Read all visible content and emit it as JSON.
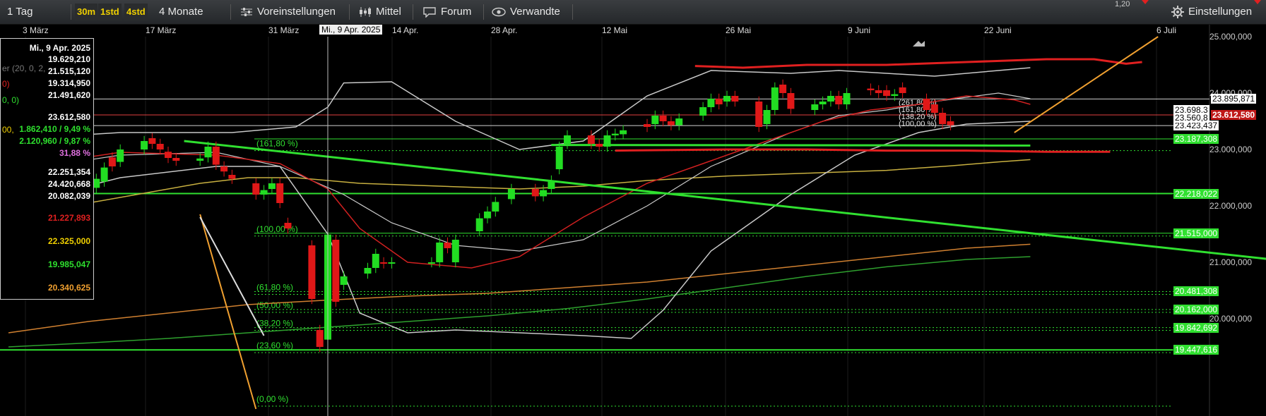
{
  "toolbar": {
    "period": "1 Tag",
    "interval_30m": "30m",
    "interval_1std": "1std",
    "interval_4std": "4std",
    "range": "4 Monate",
    "presets": "Voreinstellungen",
    "average": "Mittel",
    "forum": "Forum",
    "related": "Verwandte",
    "settings": "Einstellungen",
    "top_value": "1,20"
  },
  "date_axis": {
    "labels": [
      "3 März",
      "17 März",
      "31 März",
      "14 Apr.",
      "28 Apr.",
      "12 Mai",
      "26 Mai",
      "9 Juni",
      "22 Juni",
      "6 Juli"
    ],
    "crosshair_label": "Mi., 9 Apr. 2025"
  },
  "infobox": {
    "date": "Mi., 9 Apr. 2025",
    "values": [
      {
        "text": "19.629,210",
        "color": "#ffffff"
      },
      {
        "text": "21.515,120",
        "color": "#ffffff"
      },
      {
        "text": "19.314,950",
        "color": "#ffffff"
      },
      {
        "text": "21.491,620",
        "color": "#ffffff"
      },
      {
        "text": "23.612,580",
        "color": "#ffffff"
      },
      {
        "text": "1.862,410 / 9,49 %",
        "color": "#2ee02e"
      },
      {
        "text": "2.120,960 / 9,87 %",
        "color": "#2ee02e"
      },
      {
        "text": "31,88 %",
        "color": "#e070e0"
      },
      {
        "text": "22.251,354",
        "color": "#ffffff"
      },
      {
        "text": "24.420,668",
        "color": "#ffffff"
      },
      {
        "text": "20.082,039",
        "color": "#ffffff"
      },
      {
        "text": "21.227,893",
        "color": "#e02020"
      },
      {
        "text": "22.325,000",
        "color": "#f0d000"
      },
      {
        "text": "19.985,047",
        "color": "#2ee02e"
      },
      {
        "text": "20.340,625",
        "color": "#f0a030"
      }
    ],
    "left_fragments": [
      "er (20, 0, 2,",
      "0)",
      "0, 0)",
      "00,"
    ]
  },
  "chart_data": {
    "type": "candlestick",
    "x_start": "2025-02-28",
    "ylim": [
      18400,
      25000
    ],
    "y_ticks": [
      "25.000,000",
      "24.000,000",
      "23.000,000",
      "22.000,000",
      "21.000,000",
      "20.000,000"
    ],
    "crosshair_date": "2025-04-09",
    "candles": [
      {
        "d": "2025-02-28",
        "o": 22650,
        "c": 22520
      },
      {
        "d": "2025-03-03",
        "o": 22550,
        "c": 22500
      },
      {
        "d": "2025-03-04",
        "o": 22530,
        "c": 22320
      },
      {
        "d": "2025-03-05",
        "o": 22350,
        "c": 22500
      },
      {
        "d": "2025-03-06",
        "o": 22500,
        "c": 22320
      },
      {
        "d": "2025-03-07",
        "o": 22320,
        "c": 22450
      },
      {
        "d": "2025-03-10",
        "o": 22450,
        "c": 22280
      },
      {
        "d": "2025-03-11",
        "o": 22320,
        "c": 22480
      },
      {
        "d": "2025-03-12",
        "o": 22430,
        "c": 22680
      },
      {
        "d": "2025-03-13",
        "o": 22860,
        "c": 22700
      },
      {
        "d": "2025-03-14",
        "o": 22780,
        "c": 23000
      },
      {
        "d": "2025-03-17",
        "o": 23000,
        "c": 23150
      },
      {
        "d": "2025-03-18",
        "o": 23200,
        "c": 23100
      },
      {
        "d": "2025-03-19",
        "o": 23100,
        "c": 23000
      },
      {
        "d": "2025-03-20",
        "o": 22960,
        "c": 22850
      },
      {
        "d": "2025-03-21",
        "o": 22850,
        "c": 22800
      },
      {
        "d": "2025-03-24",
        "o": 22800,
        "c": 22840
      },
      {
        "d": "2025-03-25",
        "o": 22860,
        "c": 23050
      },
      {
        "d": "2025-03-26",
        "o": 23050,
        "c": 22730
      },
      {
        "d": "2025-03-27",
        "o": 22700,
        "c": 22610
      },
      {
        "d": "2025-03-28",
        "o": 22550,
        "c": 22480
      },
      {
        "d": "2025-03-31",
        "o": 22400,
        "c": 22200
      },
      {
        "d": "2025-04-01",
        "o": 22200,
        "c": 22280
      },
      {
        "d": "2025-04-02",
        "o": 22300,
        "c": 22400
      },
      {
        "d": "2025-04-03",
        "o": 22400,
        "c": 22050
      },
      {
        "d": "2025-04-04",
        "o": 21700,
        "c": 21600
      },
      {
        "d": "2025-04-07",
        "o": 21300,
        "c": 20350
      },
      {
        "d": "2025-04-08",
        "o": 19800,
        "c": 19500
      },
      {
        "d": "2025-04-09",
        "o": 19629,
        "c": 21492
      },
      {
        "d": "2025-04-10",
        "o": 21400,
        "c": 20300
      },
      {
        "d": "2025-04-11",
        "o": 20600,
        "c": 20750
      },
      {
        "d": "2025-04-14",
        "o": 20800,
        "c": 20900
      },
      {
        "d": "2025-04-15",
        "o": 20900,
        "c": 21150
      },
      {
        "d": "2025-04-16",
        "o": 21000,
        "c": 20980
      },
      {
        "d": "2025-04-17",
        "o": 20980,
        "c": 21000
      },
      {
        "d": "2025-04-22",
        "o": 21000,
        "c": 21000
      },
      {
        "d": "2025-04-23",
        "o": 21000,
        "c": 21350
      },
      {
        "d": "2025-04-24",
        "o": 21350,
        "c": 21250
      },
      {
        "d": "2025-04-25",
        "o": 21000,
        "c": 21400
      },
      {
        "d": "2025-04-28",
        "o": 21550,
        "c": 21780
      },
      {
        "d": "2025-04-29",
        "o": 21780,
        "c": 21900
      },
      {
        "d": "2025-04-30",
        "o": 21900,
        "c": 22070
      },
      {
        "d": "2025-05-02",
        "o": 22120,
        "c": 22300
      },
      {
        "d": "2025-05-05",
        "o": 22300,
        "c": 22170
      },
      {
        "d": "2025-05-06",
        "o": 22170,
        "c": 22280
      },
      {
        "d": "2025-05-07",
        "o": 22300,
        "c": 22450
      },
      {
        "d": "2025-05-08",
        "o": 22650,
        "c": 23050
      },
      {
        "d": "2025-05-09",
        "o": 23100,
        "c": 23250
      },
      {
        "d": "2025-05-12",
        "o": 23250,
        "c": 23100
      },
      {
        "d": "2025-05-13",
        "o": 23100,
        "c": 23050
      },
      {
        "d": "2025-05-14",
        "o": 23050,
        "c": 23250
      },
      {
        "d": "2025-05-15",
        "o": 23250,
        "c": 23280
      },
      {
        "d": "2025-05-16",
        "o": 23270,
        "c": 23340
      },
      {
        "d": "2025-05-19",
        "o": 23450,
        "c": 23400
      },
      {
        "d": "2025-05-20",
        "o": 23450,
        "c": 23600
      },
      {
        "d": "2025-05-21",
        "o": 23600,
        "c": 23500
      },
      {
        "d": "2025-05-22",
        "o": 23500,
        "c": 23430
      },
      {
        "d": "2025-05-23",
        "o": 23430,
        "c": 23550
      },
      {
        "d": "2025-05-26",
        "o": 23600,
        "c": 23750
      },
      {
        "d": "2025-05-27",
        "o": 23750,
        "c": 23900
      },
      {
        "d": "2025-05-28",
        "o": 23900,
        "c": 23800
      },
      {
        "d": "2025-05-29",
        "o": 23850,
        "c": 23950
      },
      {
        "d": "2025-05-30",
        "o": 23950,
        "c": 23850
      },
      {
        "d": "2025-06-02",
        "o": 23850,
        "c": 23400
      },
      {
        "d": "2025-06-03",
        "o": 23450,
        "c": 23700
      },
      {
        "d": "2025-06-04",
        "o": 23700,
        "c": 24100
      },
      {
        "d": "2025-06-05",
        "o": 24150,
        "c": 24000
      },
      {
        "d": "2025-06-06",
        "o": 24000,
        "c": 23720
      },
      {
        "d": "2025-06-09",
        "o": 23700,
        "c": 23800
      },
      {
        "d": "2025-06-10",
        "o": 23800,
        "c": 23850
      },
      {
        "d": "2025-06-11",
        "o": 23850,
        "c": 23950
      },
      {
        "d": "2025-06-12",
        "o": 23950,
        "c": 23800
      },
      {
        "d": "2025-06-13",
        "o": 23800,
        "c": 24000
      },
      {
        "d": "2025-06-16",
        "o": 24080,
        "c": 24050
      },
      {
        "d": "2025-06-17",
        "o": 24050,
        "c": 24000
      },
      {
        "d": "2025-06-18",
        "o": 24050,
        "c": 23950
      },
      {
        "d": "2025-06-19",
        "o": 23950,
        "c": 23980
      },
      {
        "d": "2025-06-20",
        "o": 24100,
        "c": 24000
      },
      {
        "d": "2025-06-23",
        "o": 23900,
        "c": 23700
      },
      {
        "d": "2025-06-24",
        "o": 23800,
        "c": 23650
      },
      {
        "d": "2025-06-25",
        "o": 23650,
        "c": 23450
      },
      {
        "d": "2025-06-26",
        "o": 23500,
        "c": 23430
      }
    ],
    "bollinger": {
      "upper": [
        [
          0,
          23180
        ],
        [
          14,
          23300
        ],
        [
          28,
          23300
        ],
        [
          36,
          23400
        ],
        [
          40,
          23750
        ],
        [
          42,
          24180
        ],
        [
          48,
          24200
        ],
        [
          56,
          23500
        ],
        [
          64,
          23000
        ],
        [
          72,
          23150
        ],
        [
          80,
          23950
        ],
        [
          88,
          24400
        ],
        [
          98,
          24350
        ],
        [
          104,
          24400
        ],
        [
          110,
          24350
        ],
        [
          116,
          24300
        ],
        [
          124,
          24400
        ],
        [
          128,
          24450
        ]
      ],
      "middle": [
        [
          0,
          22600
        ],
        [
          14,
          22900
        ],
        [
          26,
          22950
        ],
        [
          34,
          22700
        ],
        [
          42,
          22200
        ],
        [
          48,
          21700
        ],
        [
          56,
          21300
        ],
        [
          64,
          21200
        ],
        [
          72,
          21400
        ],
        [
          80,
          22000
        ],
        [
          88,
          22700
        ],
        [
          98,
          23300
        ],
        [
          104,
          23600
        ],
        [
          110,
          23700
        ],
        [
          116,
          23850
        ],
        [
          124,
          24000
        ],
        [
          128,
          23900
        ]
      ],
      "lower": [
        [
          0,
          22000
        ],
        [
          14,
          22500
        ],
        [
          26,
          22700
        ],
        [
          34,
          22700
        ],
        [
          40,
          21500
        ],
        [
          44,
          20100
        ],
        [
          50,
          19750
        ],
        [
          56,
          19800
        ],
        [
          64,
          19750
        ],
        [
          72,
          19700
        ],
        [
          78,
          19650
        ],
        [
          82,
          20150
        ],
        [
          88,
          21200
        ],
        [
          98,
          22200
        ],
        [
          106,
          22900
        ],
        [
          114,
          23300
        ],
        [
          120,
          23450
        ],
        [
          128,
          23500
        ]
      ]
    },
    "ema20": [
      [
        0,
        22650
      ],
      [
        14,
        22950
      ],
      [
        26,
        22900
      ],
      [
        34,
        22750
      ],
      [
        40,
        22300
      ],
      [
        44,
        21600
      ],
      [
        50,
        21000
      ],
      [
        58,
        20900
      ],
      [
        64,
        21100
      ],
      [
        72,
        21800
      ],
      [
        80,
        22400
      ],
      [
        88,
        22800
      ],
      [
        96,
        23200
      ],
      [
        102,
        23500
      ],
      [
        108,
        23700
      ],
      [
        114,
        23800
      ],
      [
        120,
        23950
      ],
      [
        126,
        23880
      ],
      [
        128,
        23800
      ]
    ],
    "sma50": [
      [
        0,
        21800
      ],
      [
        8,
        22000
      ],
      [
        16,
        22200
      ],
      [
        24,
        22400
      ],
      [
        30,
        22500
      ],
      [
        36,
        22500
      ],
      [
        44,
        22400
      ],
      [
        54,
        22350
      ],
      [
        64,
        22300
      ],
      [
        72,
        22350
      ],
      [
        80,
        22450
      ],
      [
        90,
        22530
      ],
      [
        100,
        22580
      ],
      [
        110,
        22630
      ],
      [
        118,
        22710
      ],
      [
        124,
        22780
      ],
      [
        128,
        22820
      ]
    ],
    "sma100": [
      [
        0,
        19750
      ],
      [
        10,
        19950
      ],
      [
        20,
        20100
      ],
      [
        30,
        20250
      ],
      [
        40,
        20330
      ],
      [
        50,
        20400
      ],
      [
        60,
        20450
      ],
      [
        70,
        20550
      ],
      [
        80,
        20650
      ],
      [
        90,
        20800
      ],
      [
        100,
        20950
      ],
      [
        110,
        21100
      ],
      [
        120,
        21250
      ],
      [
        128,
        21320
      ]
    ],
    "sma200": [
      [
        0,
        19500
      ],
      [
        10,
        19570
      ],
      [
        20,
        19650
      ],
      [
        30,
        19750
      ],
      [
        40,
        19850
      ],
      [
        50,
        19950
      ],
      [
        60,
        20050
      ],
      [
        70,
        20180
      ],
      [
        80,
        20350
      ],
      [
        90,
        20550
      ],
      [
        100,
        20750
      ],
      [
        110,
        20920
      ],
      [
        120,
        21050
      ],
      [
        128,
        21100
      ]
    ],
    "red_channel": {
      "upper": [
        [
          86,
          24480
        ],
        [
          92,
          24450
        ],
        [
          100,
          24500
        ],
        [
          110,
          24500
        ],
        [
          120,
          24550
        ],
        [
          130,
          24600
        ],
        [
          136,
          24600
        ],
        [
          140,
          24520
        ],
        [
          142,
          24550
        ]
      ],
      "lower": [
        [
          76,
          22980
        ],
        [
          90,
          23000
        ],
        [
          100,
          23000
        ],
        [
          110,
          22980
        ],
        [
          120,
          22980
        ],
        [
          130,
          22960
        ],
        [
          138,
          22960
        ]
      ]
    },
    "trendlines": [
      {
        "name": "main_down",
        "color": "#30e030",
        "from": [
          22,
          23150
        ],
        "to": [
          181,
          20700
        ]
      },
      {
        "name": "green_mid",
        "color": "#30e030",
        "from": [
          68,
          23080
        ],
        "to": [
          128,
          23070
        ]
      },
      {
        "name": "orange_up",
        "color": "#f0a030",
        "from": [
          126,
          23300
        ],
        "to": [
          144,
          25000
        ]
      },
      {
        "name": "orange_drop",
        "color": "#f0a030",
        "from": [
          24,
          21850
        ],
        "to": [
          31,
          18400
        ]
      },
      {
        "name": "white_drop",
        "color": "#dddddd",
        "from": [
          24,
          21800
        ],
        "to": [
          32,
          19700
        ]
      }
    ],
    "horizontal_levels": [
      {
        "value": 23895.871,
        "label": "23.895,871",
        "style": "white"
      },
      {
        "value": 23612.58,
        "label": "23.612,580",
        "style": "red"
      },
      {
        "value": 23423.437,
        "label": "23.423,437",
        "style": "white"
      },
      {
        "value": 23187.308,
        "label": "23.187,308",
        "style": "green"
      },
      {
        "value": 22218.022,
        "label": "22.218,022",
        "style": "green"
      },
      {
        "value": 21515.0,
        "label": "21.515,000",
        "style": "green"
      },
      {
        "value": 20481.308,
        "label": "20.481,308",
        "style": "green"
      },
      {
        "value": 20162.0,
        "label": "20.162,000",
        "style": "green"
      },
      {
        "value": 19842.692,
        "label": "19.842,692",
        "style": "green"
      },
      {
        "value": 19447.616,
        "label": "19.447,616",
        "style": "green"
      }
    ],
    "extra_tags": [
      {
        "value": 23698.3,
        "label": "23.698,3"
      },
      {
        "value": 23560.8,
        "label": "23.560,8"
      }
    ],
    "fib_levels": [
      {
        "value": 23030,
        "label": "(161,80 %)"
      },
      {
        "value": 21515,
        "label": "(100,00 %)"
      },
      {
        "value": 20481,
        "label": "(61,80 %)"
      },
      {
        "value": 20162,
        "label": "(50,00 %)"
      },
      {
        "value": 19843,
        "label": "(38,20 %)"
      },
      {
        "value": 19448,
        "label": "(23,60 %)"
      },
      {
        "value": 18500,
        "label": "(0,00 %)"
      }
    ],
    "fib_right_labels": [
      "(261,80 %)",
      "(161,80 %)",
      "(138,20 %)",
      "(100,00 %)"
    ],
    "long_horizontals": [
      {
        "value": 22218.022,
        "color": "#30e030"
      },
      {
        "value": 19447.616,
        "color": "#30e030"
      }
    ]
  }
}
